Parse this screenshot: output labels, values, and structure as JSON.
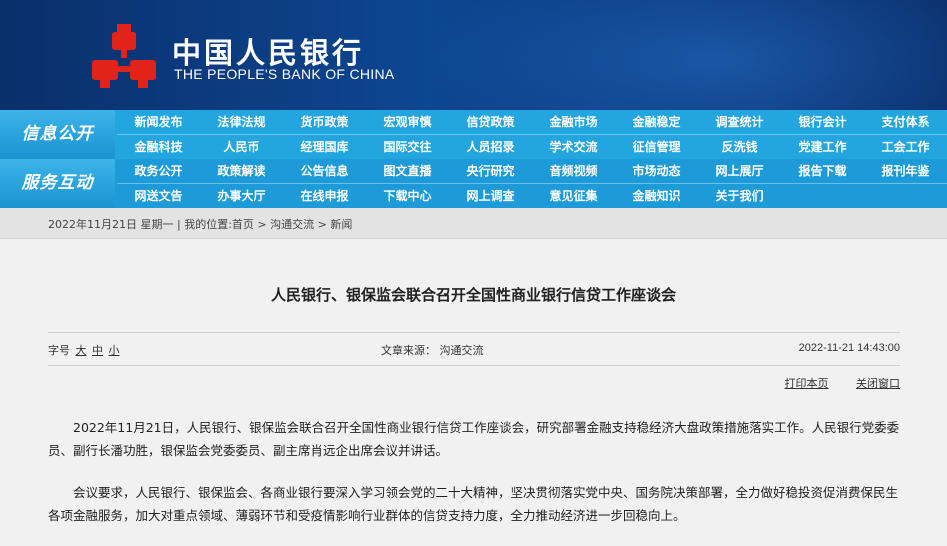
{
  "header": {
    "logo_cn": "中国人民银行",
    "logo_en": "THE PEOPLE'S BANK OF CHINA",
    "logo_color": "#e2231a"
  },
  "nav": {
    "group1_label": "信息公开",
    "group2_label": "服务互动",
    "row1": [
      "新闻发布",
      "法律法规",
      "货币政策",
      "宏观审慎",
      "信贷政策",
      "金融市场",
      "金融稳定",
      "调查统计",
      "银行会计",
      "支付体系"
    ],
    "row2": [
      "金融科技",
      "人民币",
      "经理国库",
      "国际交往",
      "人员招录",
      "学术交流",
      "征信管理",
      "反洗钱",
      "党建工作",
      "工会工作"
    ],
    "row3": [
      "政务公开",
      "政策解读",
      "公告信息",
      "图文直播",
      "央行研究",
      "音频视频",
      "市场动态",
      "网上展厅",
      "报告下载",
      "报刊年鉴"
    ],
    "row4": [
      "网送文告",
      "办事大厅",
      "在线申报",
      "下载中心",
      "网上调查",
      "意见征集",
      "金融知识",
      "关于我们"
    ]
  },
  "breadcrumb": {
    "date": "2022年11月21日 星期一",
    "prefix": "我的位置:",
    "items": [
      "首页",
      "沟通交流",
      "新闻"
    ]
  },
  "article": {
    "title": "人民银行、银保监会联合召开全国性商业银行信贷工作座谈会",
    "font_size_label": "字号",
    "font_sizes": [
      "大",
      "中",
      "小"
    ],
    "source": "文章来源：  沟通交流",
    "datetime": "2022-11-21 14:43:00",
    "print_label": "打印本页",
    "close_label": "关闭窗口",
    "paragraphs": [
      "2022年11月21日，人民银行、银保监会联合召开全国性商业银行信贷工作座谈会，研究部署金融支持稳经济大盘政策措施落实工作。人民银行党委委员、副行长潘功胜，银保监会党委委员、副主席肖远企出席会议并讲话。",
      "会议要求，人民银行、银保监会、各商业银行要深入学习领会党的二十大精神，坚决贯彻落实党中央、国务院决策部署，全力做好稳投资促消费保民生各项金融服务，加大对重点领域、薄弱环节和受疫情影响行业群体的信贷支持力度，全力推动经济进一步回稳向上。"
    ]
  }
}
